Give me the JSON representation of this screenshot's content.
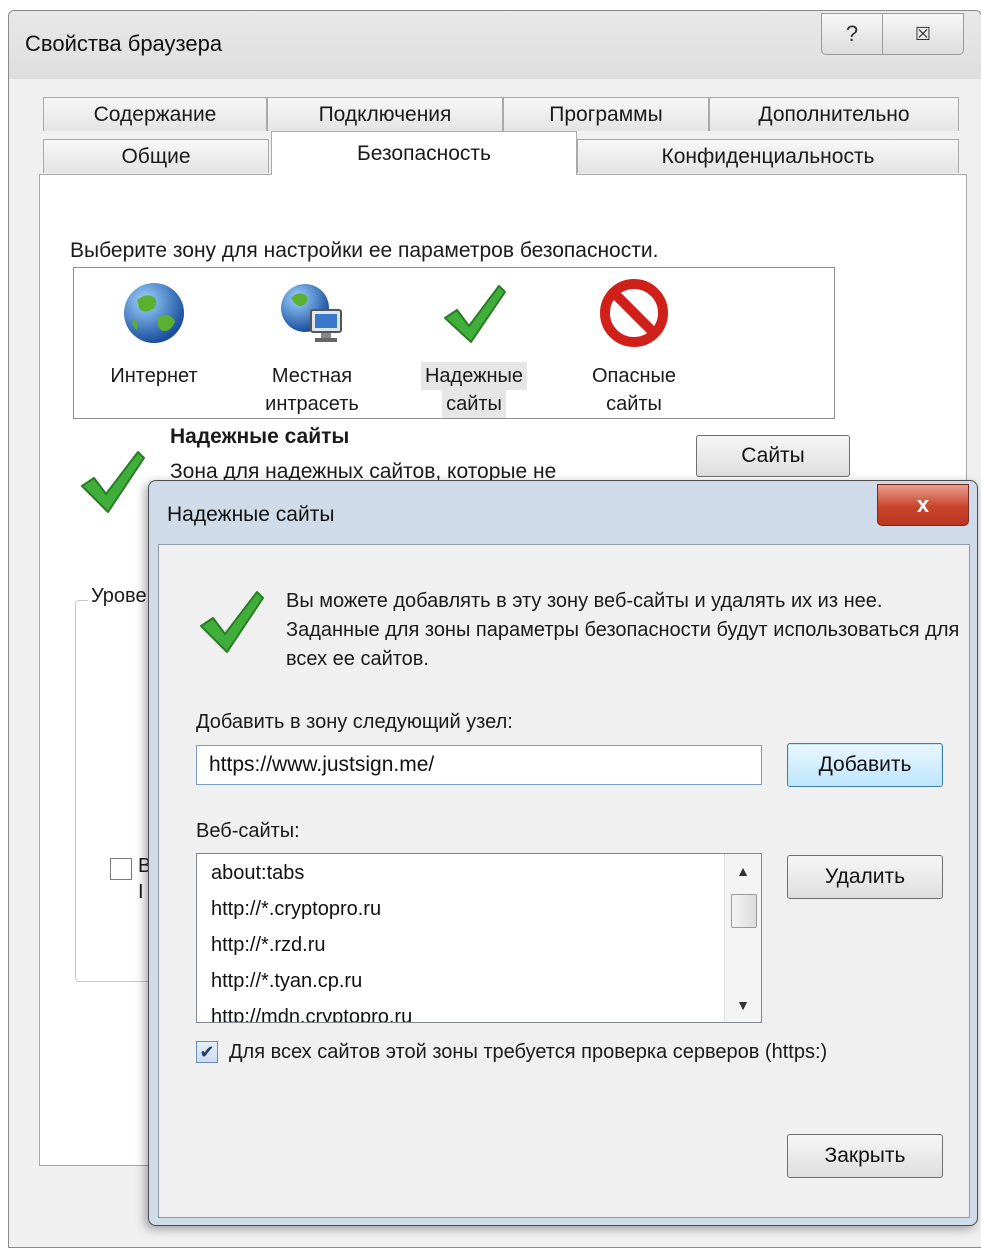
{
  "outer_dialog": {
    "title": "Свойства браузера",
    "help_glyph": "?",
    "close_glyph": "☒",
    "tabs_row1": [
      "Содержание",
      "Подключения",
      "Программы",
      "Дополнительно"
    ],
    "tabs_row2": [
      "Общие",
      "Безопасность",
      "Конфиденциальность"
    ],
    "active_tab": "Безопасность",
    "zone_prompt": "Выберите зону для настройки ее параметров безопасности.",
    "zones": [
      {
        "label_line1": "Интернет",
        "label_line2": "",
        "icon": "globe-icon"
      },
      {
        "label_line1": "Местная",
        "label_line2": "интрасеть",
        "icon": "globe-computer-icon"
      },
      {
        "label_line1": "Надежные",
        "label_line2": "сайты",
        "icon": "checkmark-icon"
      },
      {
        "label_line1": "Опасные",
        "label_line2": "сайты",
        "icon": "forbidden-icon"
      }
    ],
    "selected_zone": "Надежные сайты",
    "zone_title": "Надежные сайты",
    "zone_description": "Зона для надежных сайтов, которые не",
    "sites_button": "Сайты",
    "level_label": "Урове",
    "checkbox_text_line1": "В",
    "checkbox_text_line2": "I"
  },
  "trusted_sites_dialog": {
    "title": "Надежные сайты",
    "close_glyph": "x",
    "info_text": "Вы можете добавлять в эту зону  веб-сайты и удалять их из нее. Заданные для зоны параметры безопасности будут использоваться для всех ее сайтов.",
    "add_label": "Добавить в зону следующий узел:",
    "url_value": "https://www.justsign.me/",
    "add_button": "Добавить",
    "sites_label": "Веб-сайты:",
    "sites": [
      "about:tabs",
      "http://*.cryptopro.ru",
      "http://*.rzd.ru",
      "http://*.tyan.cp.ru",
      "http://mdn.cryptopro.ru"
    ],
    "remove_button": "Удалить",
    "require_https_checked": true,
    "require_https_label": "Для всех сайтов этой зоны требуется проверка серверов (https:)",
    "close_button": "Закрыть"
  },
  "colors": {
    "check_green": "#3fae3a",
    "forbidden_red": "#d0201a",
    "globe_blue": "#2a6fc4",
    "globe_green": "#5cb030"
  }
}
